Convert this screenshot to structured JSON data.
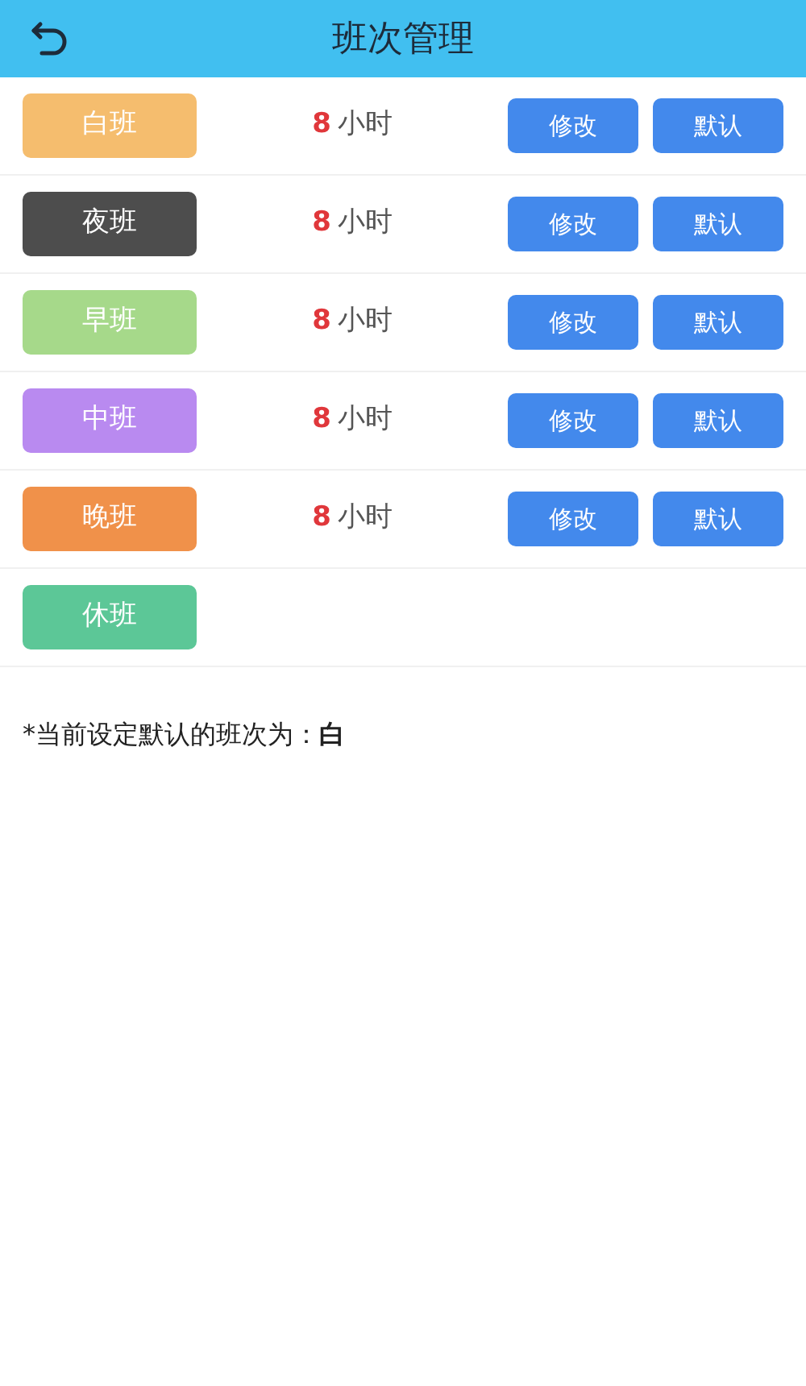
{
  "header": {
    "title": "班次管理"
  },
  "shifts": [
    {
      "name": "白班",
      "color": "#f5bd6e",
      "hours": "8",
      "unit": "小时",
      "actions": [
        "修改",
        "默认"
      ]
    },
    {
      "name": "夜班",
      "color": "#4d4d4d",
      "hours": "8",
      "unit": "小时",
      "actions": [
        "修改",
        "默认"
      ]
    },
    {
      "name": "早班",
      "color": "#a6d98a",
      "hours": "8",
      "unit": "小时",
      "actions": [
        "修改",
        "默认"
      ]
    },
    {
      "name": "中班",
      "color": "#b98af0",
      "hours": "8",
      "unit": "小时",
      "actions": [
        "修改",
        "默认"
      ]
    },
    {
      "name": "晚班",
      "color": "#f0914a",
      "hours": "8",
      "unit": "小时",
      "actions": [
        "修改",
        "默认"
      ]
    },
    {
      "name": "休班",
      "color": "#5cc797"
    }
  ],
  "note": "*当前设定默认的班次为：**白**"
}
